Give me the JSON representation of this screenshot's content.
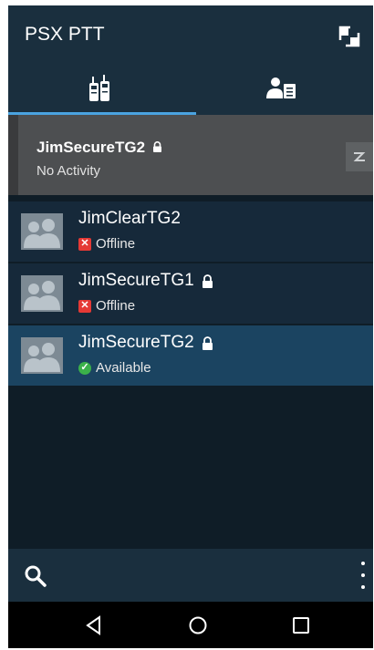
{
  "app": {
    "title": "PSX PTT"
  },
  "tabs": [
    {
      "icon": "radios-icon",
      "active": true
    },
    {
      "icon": "contacts-list-icon",
      "active": false
    }
  ],
  "active_channel": {
    "name": "JimSecureTG2",
    "locked": true,
    "status": "No Activity",
    "ptt_icon": "ptt-lightning-icon"
  },
  "talkgroups": [
    {
      "name": "JimClearTG2",
      "locked": false,
      "status": "Offline",
      "status_type": "offline",
      "selected": false
    },
    {
      "name": "JimSecureTG1",
      "locked": true,
      "status": "Offline",
      "status_type": "offline",
      "selected": false
    },
    {
      "name": "JimSecureTG2",
      "locked": true,
      "status": "Available",
      "status_type": "available",
      "selected": true
    }
  ],
  "bottom_bar": {
    "search_icon": "search-icon",
    "overflow_icon": "overflow-menu-icon"
  },
  "nav_bar": [
    "back-icon",
    "home-icon",
    "recents-icon"
  ],
  "colors": {
    "appbar": "#1a2f3e",
    "tab_indicator": "#4aa3e0",
    "active_card": "#4d4f51",
    "row": "#16293a",
    "row_selected": "#1b4461",
    "offline": "#e53935",
    "available": "#3bb14a"
  }
}
